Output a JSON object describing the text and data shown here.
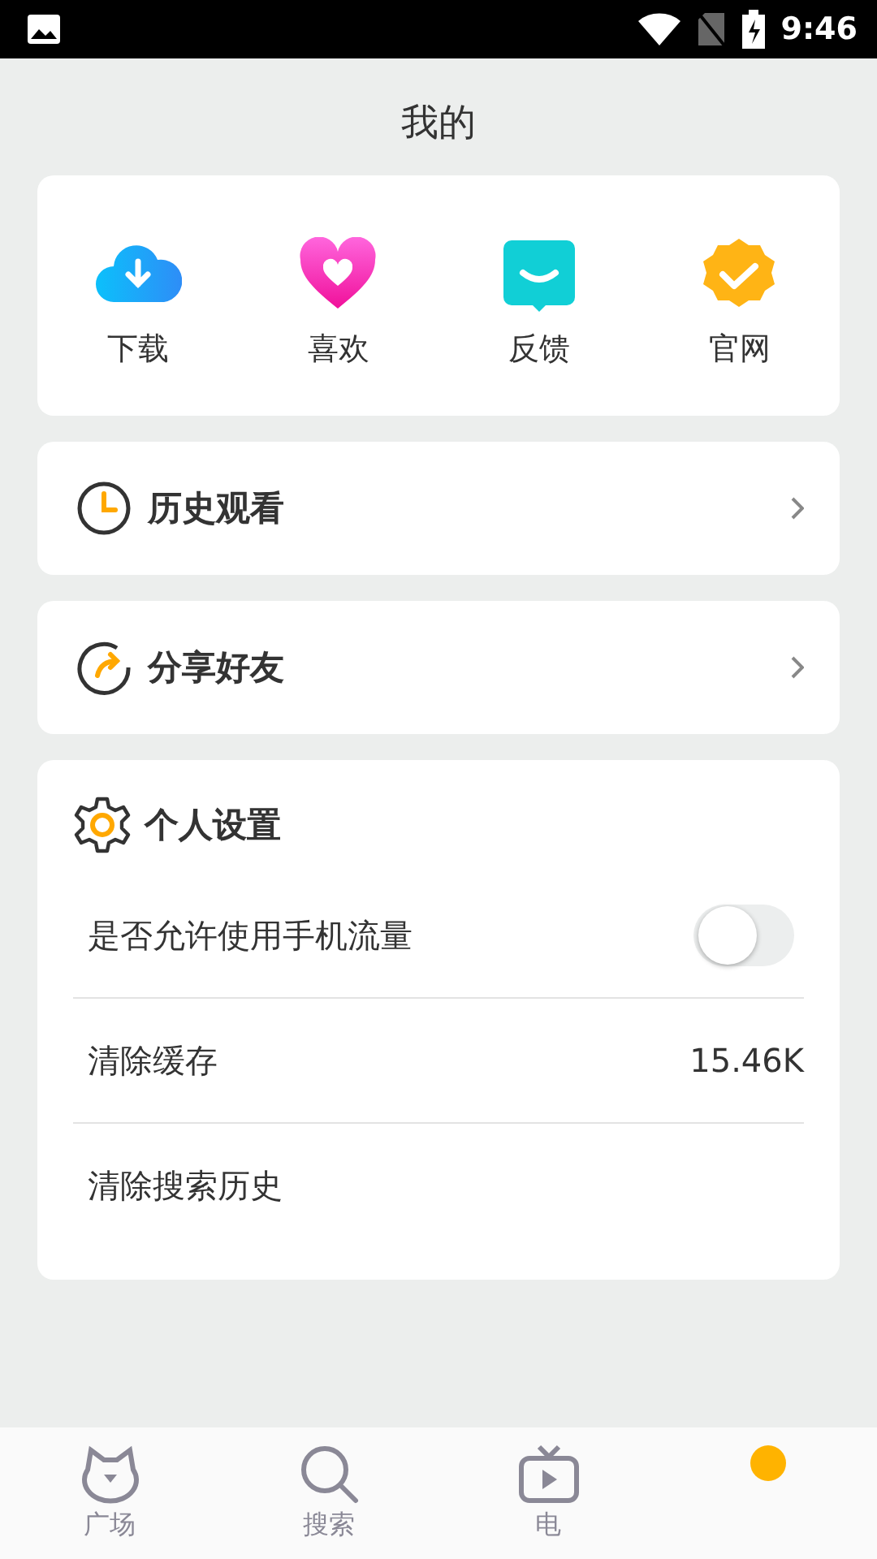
{
  "status_bar": {
    "time": "9:46"
  },
  "title": "我的",
  "shortcuts": [
    {
      "kind": "download",
      "label": "下载"
    },
    {
      "kind": "like",
      "label": "喜欢"
    },
    {
      "kind": "feedback",
      "label": "反馈"
    },
    {
      "kind": "website",
      "label": "官网"
    }
  ],
  "links": [
    {
      "kind": "history",
      "label": "历史观看"
    },
    {
      "kind": "share",
      "label": "分享好友"
    }
  ],
  "settings": {
    "title": "个人设置",
    "rows": [
      {
        "kind": "toggle",
        "label": "是否允许使用手机流量",
        "on": false
      },
      {
        "kind": "value",
        "label": "清除缓存",
        "value": "15.46K"
      },
      {
        "kind": "plain",
        "label": "清除搜索历史"
      }
    ]
  },
  "nav": [
    {
      "kind": "square",
      "label": "广场",
      "selected": false
    },
    {
      "kind": "search",
      "label": "搜索",
      "selected": false
    },
    {
      "kind": "tv",
      "label": "电",
      "selected": false
    },
    {
      "kind": "mine",
      "selected": true
    }
  ]
}
